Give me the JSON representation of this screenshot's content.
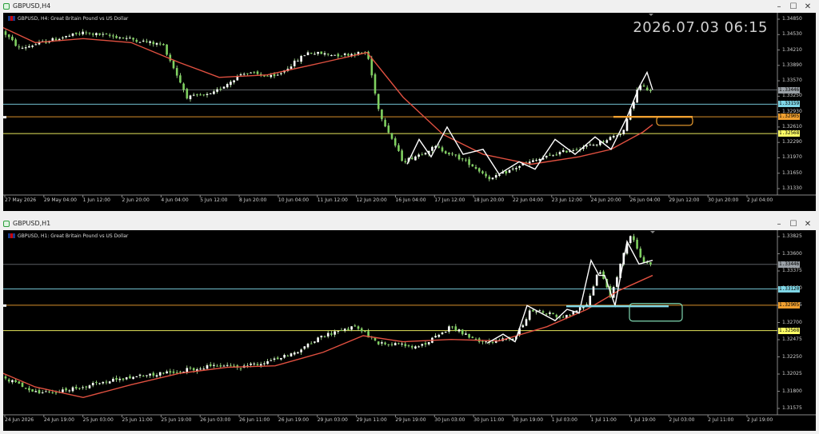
{
  "windows": [
    {
      "id": "h4",
      "title": "GBPUSD,H4",
      "label": "GBPUSD, H4:  Great Britain Pound vs US Dollar",
      "clock": "2026.07.03 06:15",
      "y_ticks": [
        "1.34850",
        "1.34530",
        "1.34210",
        "1.33890",
        "1.33570",
        "1.33250",
        "1.32930",
        "1.32610",
        "1.32290",
        "1.31970",
        "1.31650",
        "1.31330"
      ],
      "x_ticks": [
        "27 May 2026",
        "29 May 04:00",
        "1 Jun 12:00",
        "2 Jun 20:00",
        "4 Jun 04:00",
        "5 Jun 12:00",
        "8 Jun 20:00",
        "10 Jun 04:00",
        "11 Jun 12:00",
        "12 Jun 20:00",
        "16 Jun 04:00",
        "17 Jun 12:00",
        "18 Jun 20:00",
        "22 Jun 04:00",
        "23 Jun 12:00",
        "24 Jun 20:00",
        "26 Jun 04:00",
        "29 Jun 12:00",
        "30 Jun 20:00",
        "2 Jul 04:00"
      ],
      "price_tags": [
        {
          "text": "1.33446",
          "bg": "#9aa0a6",
          "fg": "#000",
          "y": 1.33446
        },
        {
          "text": "1.33159",
          "bg": "#7fd6e6",
          "fg": "#000",
          "y": 1.33159
        },
        {
          "text": "1.32905",
          "bg": "#f0a030",
          "fg": "#000",
          "y": 1.32905
        },
        {
          "text": "1.32568",
          "bg": "#ffff66",
          "fg": "#000",
          "y": 1.32568
        }
      ],
      "y_range": [
        1.3133,
        1.35
      ],
      "line_colors": {
        "grey": "#9aa0a6",
        "cyan": "#7fd6e6",
        "orange": "#f0a030",
        "yellow": "#e8e060"
      }
    },
    {
      "id": "h1",
      "title": "GBPUSD,H1",
      "label": "GBPUSD, H1:  Great Britain Pound vs US Dollar",
      "y_ticks": [
        "1.33825",
        "1.33600",
        "1.33375",
        "1.33150",
        "1.32925",
        "1.32700",
        "1.32475",
        "1.32250",
        "1.32025",
        "1.31800",
        "1.31575"
      ],
      "x_ticks": [
        "24 Jun 2026",
        "24 Jun 19:00",
        "25 Jun 03:00",
        "25 Jun 11:00",
        "25 Jun 19:00",
        "26 Jun 03:00",
        "26 Jun 11:00",
        "26 Jun 19:00",
        "29 Jun 03:00",
        "29 Jun 11:00",
        "29 Jun 19:00",
        "30 Jun 03:00",
        "30 Jun 11:00",
        "30 Jun 19:00",
        "1 Jul 03:00",
        "1 Jul 11:00",
        "1 Jul 19:00",
        "2 Jul 03:00",
        "2 Jul 11:00",
        "2 Jul 19:00"
      ],
      "price_tags": [
        {
          "text": "1.33446",
          "bg": "#9aa0a6",
          "fg": "#000",
          "y": 1.33446
        },
        {
          "text": "1.33120",
          "bg": "#7fd6e6",
          "fg": "#000",
          "y": 1.3312
        },
        {
          "text": "1.32905",
          "bg": "#f0a030",
          "fg": "#000",
          "y": 1.32905
        },
        {
          "text": "1.32568",
          "bg": "#ffff66",
          "fg": "#000",
          "y": 1.32568
        }
      ],
      "y_range": [
        1.3145,
        1.339
      ],
      "line_colors": {
        "grey": "#9aa0a6",
        "cyan": "#7fd6e6",
        "orange": "#f0a030",
        "yellow": "#e8e060"
      }
    }
  ],
  "icons": {
    "minimize": "minimize-icon",
    "maximize": "maximize-icon",
    "close": "close-icon"
  }
}
